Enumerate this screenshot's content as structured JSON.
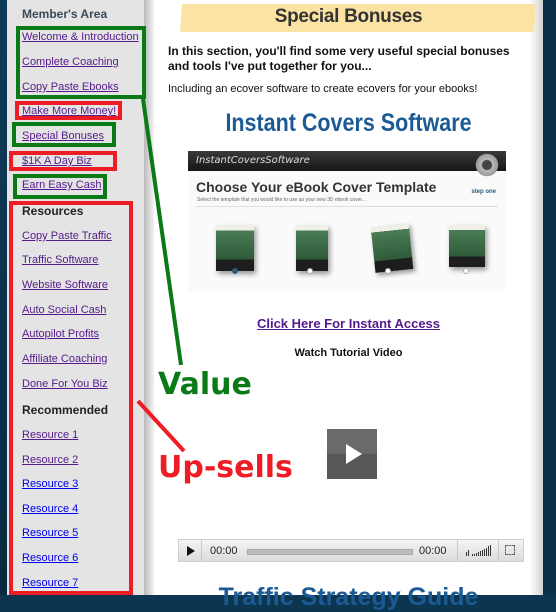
{
  "sidebar": {
    "members_heading": "Member's Area",
    "members_links": [
      "Welcome & Introduction",
      "Complete Coaching",
      "Copy Paste Ebooks",
      "Make More Money!",
      "Special Bonuses",
      "$1K A Day Biz",
      "Earn Easy Cash"
    ],
    "resources_heading": "Resources",
    "resources_links": [
      "Copy Paste Traffic",
      "Traffic Software",
      "Website Software",
      "Auto Social Cash",
      "Autopilot Profits",
      "Affiliate Coaching",
      "Done For You Biz"
    ],
    "recommended_heading": "Recommended",
    "recommended_links": [
      "Resource 1",
      "Resource 2",
      "Resource 3",
      "Resource 4",
      "Resource 5",
      "Resource 6",
      "Resource 7"
    ]
  },
  "main": {
    "title": "Special Bonuses",
    "intro": "In this section, you'll find some very useful special bonuses and tools I've put together for you...",
    "intro2": "Including an ecover software to create ecovers for your ebooks!",
    "product_heading": "Instant Covers Software",
    "product_image": {
      "brand": "InstantCoversSoftware",
      "heading": "Choose Your eBook Cover Template",
      "subheading": "Select the template that you would like to use as your new 3D ebook cover...",
      "step": "step one"
    },
    "access_link": "Click Here For Instant Access",
    "video_label": "Watch Tutorial Video",
    "player": {
      "current_time": "00:00",
      "duration": "00:00",
      "progress": 0
    },
    "next_heading": "Traffic Strategy Guide"
  },
  "annotations": {
    "value_label": "Value",
    "upsell_label": "Up-sells",
    "value_color": "#0a7a16",
    "upsell_color": "#ee1c24"
  }
}
